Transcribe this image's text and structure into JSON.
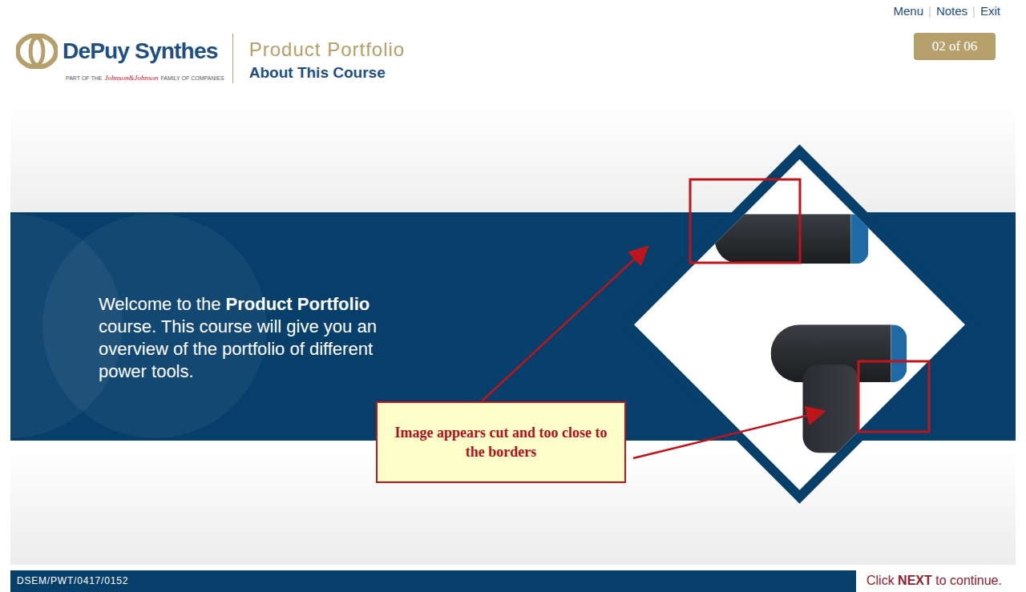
{
  "brand": {
    "name": "DePuy Synthes",
    "tagline_prefix": "PART OF THE",
    "tagline_company": "Johnson&Johnson",
    "tagline_suffix": "FAMILY OF COMPANIES"
  },
  "header": {
    "course": "Product Portfolio",
    "section": "About This Course"
  },
  "nav_links": [
    "Menu",
    "Notes",
    "Exit"
  ],
  "separator": "|",
  "page_counter": "02 of 06",
  "welcome": {
    "prefix": "Welcome to the ",
    "bold": "Product Portfolio",
    "suffix": " course. This course will give you an overview of the portfolio of different power tools."
  },
  "annotation": {
    "text": "Image appears cut and too close to the borders"
  },
  "footer": {
    "code": "DSEM/PWT/0417/0152",
    "prompt_prefix": "Click ",
    "prompt_bold": "NEXT",
    "prompt_suffix": " to continue."
  }
}
